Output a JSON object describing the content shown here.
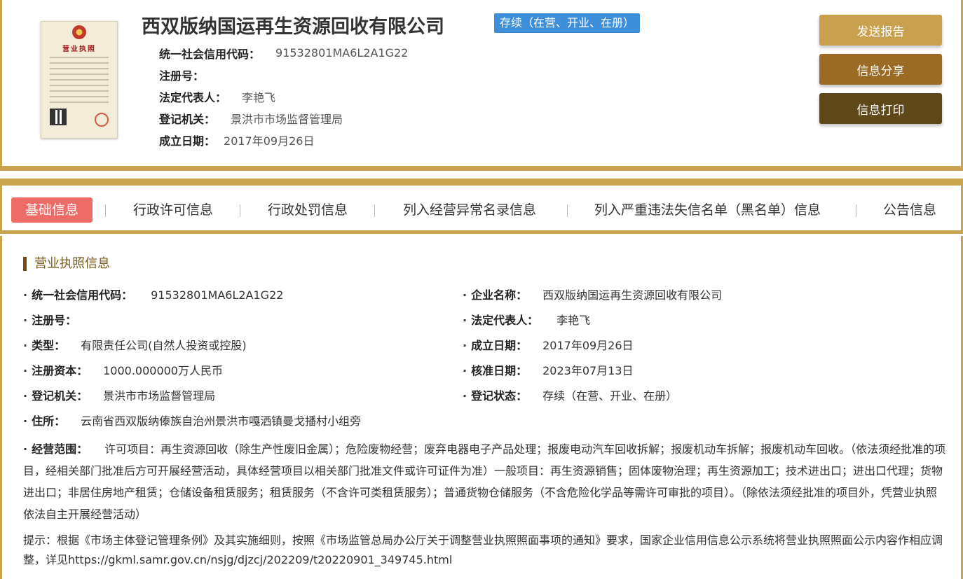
{
  "header": {
    "company_name": "西双版纳国运再生资源回收有限公司",
    "status": "存续（在营、开业、在册）",
    "fields": [
      {
        "label": "统一社会信用代码：",
        "value": "91532801MA6L2A1G22"
      },
      {
        "label": "注册号：",
        "value": ""
      },
      {
        "label": "法定代表人：",
        "value": "李艳飞"
      },
      {
        "label": "登记机关：",
        "value": "景洪市市场监督管理局"
      },
      {
        "label": "成立日期：",
        "value": "2017年09月26日"
      }
    ],
    "license_thumb": {
      "title": "营业执照",
      "icon": "business-license-image"
    }
  },
  "actions": {
    "report": "发送报告",
    "share": "信息分享",
    "print": "信息打印"
  },
  "tabs": [
    {
      "label": "基础信息",
      "active": true
    },
    {
      "label": "行政许可信息",
      "active": false
    },
    {
      "label": "行政处罚信息",
      "active": false
    },
    {
      "label": "列入经营异常名录信息",
      "active": false
    },
    {
      "label": "列入严重违法失信名单（黑名单）信息",
      "active": false
    },
    {
      "label": "公告信息",
      "active": false
    }
  ],
  "section": {
    "title": "营业执照信息",
    "left": [
      {
        "label": "统一社会信用代码：",
        "value": "91532801MA6L2A1G22"
      },
      {
        "label": "注册号：",
        "value": ""
      },
      {
        "label": "类型：",
        "value": "有限责任公司(自然人投资或控股)"
      },
      {
        "label": "注册资本：",
        "value": "1000.000000万人民币"
      },
      {
        "label": "登记机关：",
        "value": "景洪市市场监督管理局"
      },
      {
        "label": "住所：",
        "value": "云南省西双版纳傣族自治州景洪市嘎洒镇曼戈播村小组旁"
      }
    ],
    "right": [
      {
        "label": "企业名称：",
        "value": "西双版纳国运再生资源回收有限公司"
      },
      {
        "label": "法定代表人：",
        "value": "李艳飞"
      },
      {
        "label": "成立日期：",
        "value": "2017年09月26日"
      },
      {
        "label": "核准日期：",
        "value": "2023年07月13日"
      },
      {
        "label": "登记状态：",
        "value": "存续（在营、开业、在册）"
      }
    ],
    "scope_label": "经营范围：",
    "scope_value": "许可项目：再生资源回收（除生产性废旧金属）；危险废物经营；废弃电器电子产品处理；报废电动汽车回收拆解；报废机动车拆解；报废机动车回收。（依法须经批准的项目，经相关部门批准后方可开展经营活动，具体经营项目以相关部门批准文件或许可证件为准）一般项目：再生资源销售；固体废物治理；再生资源加工；技术进出口；进出口代理；货物进出口；非居住房地产租赁；仓储设备租赁服务；租赁服务（不含许可类租赁服务）；普通货物仓储服务（不含危险化学品等需许可审批的项目）。（除依法须经批准的项目外，凭营业执照依法自主开展经营活动）",
    "hint": "提示：根据《市场主体登记管理条例》及其实施细则，按照《市场监管总局办公厅关于调整营业执照照面事项的通知》要求，国家企业信用信息公示系统将营业执照照面公示内容作相应调整，详见https://gkml.samr.gov.cn/nsjg/djzcj/202209/t20220901_349745.html"
  },
  "colors": {
    "gold_border": "#c9a34d",
    "btn_report": "#c9a04e",
    "btn_share": "#9b6a25",
    "btn_print": "#5e4718",
    "status_badge": "#3d8fdb",
    "active_tab": "#ee6b67",
    "section_title": "#7a5a1e"
  }
}
